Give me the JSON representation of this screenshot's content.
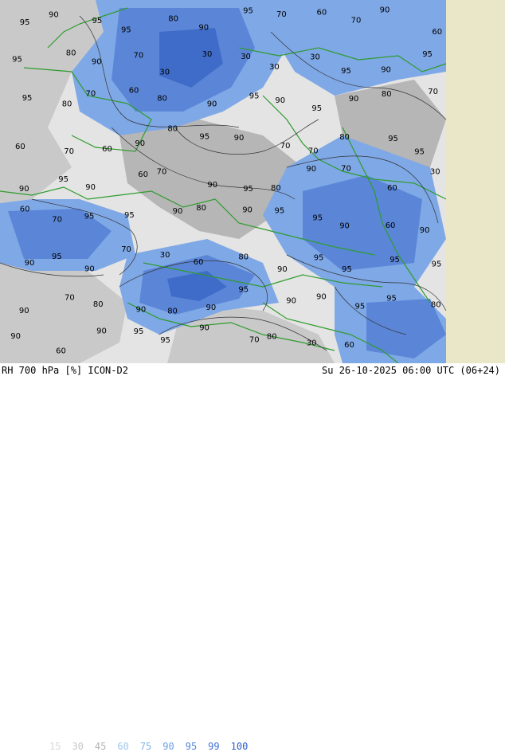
{
  "header": {
    "product": "RH 700 hPa [%] ICON-D2",
    "valid_time": "Su 26-10-2025 06:00 UTC (06+24)"
  },
  "legend": {
    "items": [
      {
        "label": "15",
        "color": "#d8d8d8"
      },
      {
        "label": "30",
        "color": "#c6c6c6"
      },
      {
        "label": "45",
        "color": "#b3b3b3"
      },
      {
        "label": "60",
        "color": "#9ec8f0"
      },
      {
        "label": "75",
        "color": "#7fb2ea"
      },
      {
        "label": "90",
        "color": "#6a9ee4"
      },
      {
        "label": "95",
        "color": "#5586de"
      },
      {
        "label": "99",
        "color": "#3f6fd6"
      },
      {
        "label": "100",
        "color": "#2c5cc8"
      }
    ]
  },
  "map": {
    "colors": {
      "background": "#e4e4e4",
      "dry_gray": "#b6b6b6",
      "mid_gray": "#c9c9c9",
      "moist_blue": "#7fa8e6",
      "wet_blue": "#5b86d8",
      "very_wet": "#3f6cc8",
      "outside_domain": "#e9e7c8",
      "borders": "#2e9c2e",
      "contours": "#333333"
    },
    "contour_labels": [
      "95",
      "90",
      "95",
      "95",
      "80",
      "90",
      "95",
      "70",
      "60",
      "70",
      "90",
      "60",
      "95",
      "80",
      "90",
      "70",
      "30",
      "30",
      "30",
      "30",
      "30",
      "95",
      "90",
      "95",
      "95",
      "80",
      "70",
      "60",
      "80",
      "90",
      "95",
      "90",
      "95",
      "90",
      "80",
      "70",
      "60",
      "70",
      "60",
      "90",
      "80",
      "95",
      "90",
      "70",
      "70",
      "80",
      "95",
      "95",
      "90",
      "95",
      "90",
      "60",
      "70",
      "90",
      "95",
      "80",
      "90",
      "70",
      "60",
      "30",
      "60",
      "70",
      "95",
      "95",
      "90",
      "80",
      "90",
      "95",
      "95",
      "90",
      "60",
      "90",
      "90",
      "95",
      "90",
      "70",
      "30",
      "60",
      "80",
      "90",
      "95",
      "95",
      "95",
      "95",
      "90",
      "70",
      "80",
      "90",
      "80",
      "90",
      "95",
      "90",
      "90",
      "95",
      "95",
      "80",
      "90",
      "60",
      "90",
      "95",
      "95",
      "90",
      "70",
      "80",
      "30",
      "60"
    ]
  }
}
